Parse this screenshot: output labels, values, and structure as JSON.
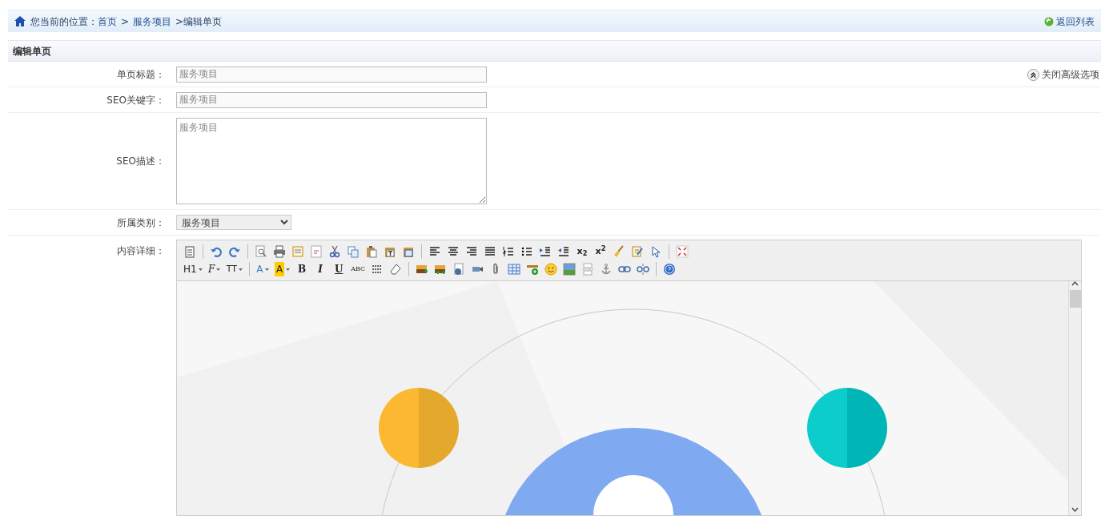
{
  "breadcrumb": {
    "prefix": "您当前的位置：",
    "links": [
      "首页",
      "服务项目"
    ],
    "separator": ">",
    "current": ">编辑单页",
    "back_link": "返回列表"
  },
  "panel": {
    "title": "编辑单页",
    "advanced_toggle": "关闭高级选项"
  },
  "fields": [
    {
      "kind": "text",
      "label": "单页标题：",
      "value": "服务项目"
    },
    {
      "kind": "text",
      "label": "SEO关键字：",
      "value": "服务项目"
    },
    {
      "kind": "textarea",
      "label": "SEO描述：",
      "value": "服务项目"
    },
    {
      "kind": "select",
      "label": "所属类别：",
      "value": "服务项目"
    },
    {
      "kind": "editor",
      "label": "内容详细："
    }
  ],
  "toolbar": {
    "texts": [
      "x$_{2}$",
      "x$^{2}$",
      "H1",
      "F",
      "TT",
      "A",
      "A",
      "B",
      "I",
      "U",
      "ABC"
    ]
  }
}
